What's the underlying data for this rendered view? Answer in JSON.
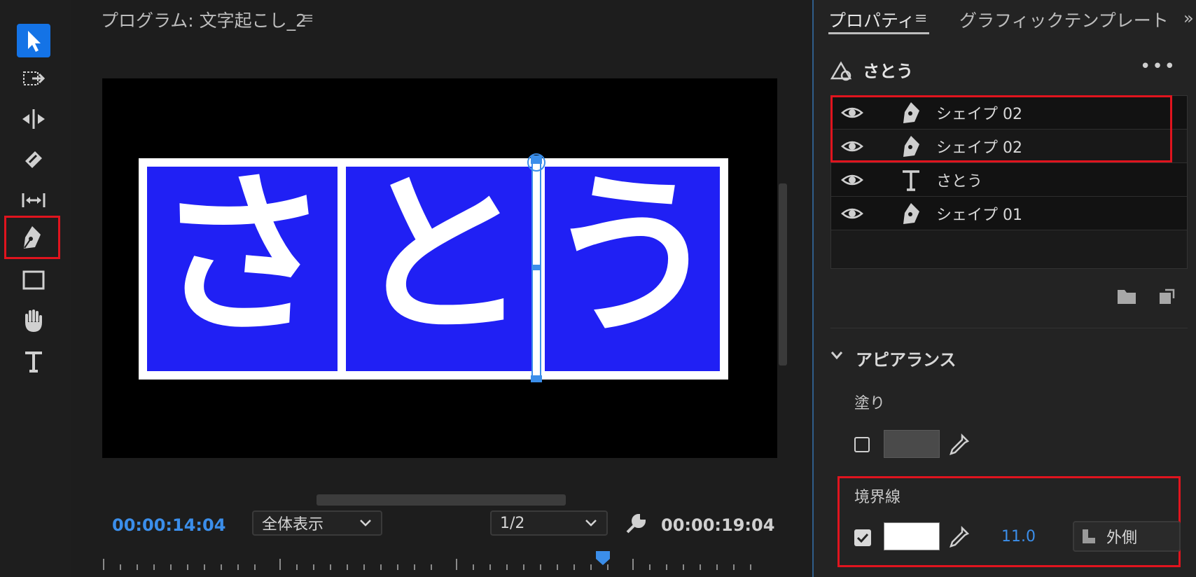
{
  "program": {
    "title": "プログラム: 文字起こし_2",
    "menu_glyph": "≡",
    "timecode_current": "00:00:14:04",
    "timecode_duration": "00:00:19:04",
    "zoom_select": "全体表示",
    "resolution_select": "1/2"
  },
  "canvas": {
    "characters": [
      "さ",
      "と",
      "う"
    ],
    "tile_color": "#2020f4",
    "border_color": "#ffffff"
  },
  "tools": [
    {
      "name": "selection-tool",
      "active": true
    },
    {
      "name": "track-select-tool"
    },
    {
      "name": "ripple-edit-tool"
    },
    {
      "name": "razor-tool"
    },
    {
      "name": "slip-tool"
    },
    {
      "name": "pen-tool",
      "highlighted": true
    },
    {
      "name": "rectangle-tool"
    },
    {
      "name": "hand-tool"
    },
    {
      "name": "type-tool"
    }
  ],
  "properties": {
    "tab_properties": "プロパティ",
    "tab_menu": "≡",
    "tab_graphic_templates": "グラフィックテンプレート",
    "tab_overflow": "»",
    "object_name": "さとう",
    "more": "•••",
    "layers": [
      {
        "name": "シェイプ 02",
        "type": "pen-icon"
      },
      {
        "name": "シェイプ 02",
        "type": "pen-icon"
      },
      {
        "name": "さとう",
        "type": "text-icon"
      },
      {
        "name": "シェイプ 01",
        "type": "pen-icon"
      }
    ],
    "appearance_title": "アピアランス",
    "fill_label": "塗り",
    "fill_color": "#4a4a4a",
    "stroke_label": "境界線",
    "stroke_color": "#ffffff",
    "stroke_width": "11.0",
    "stroke_position": "外側"
  }
}
